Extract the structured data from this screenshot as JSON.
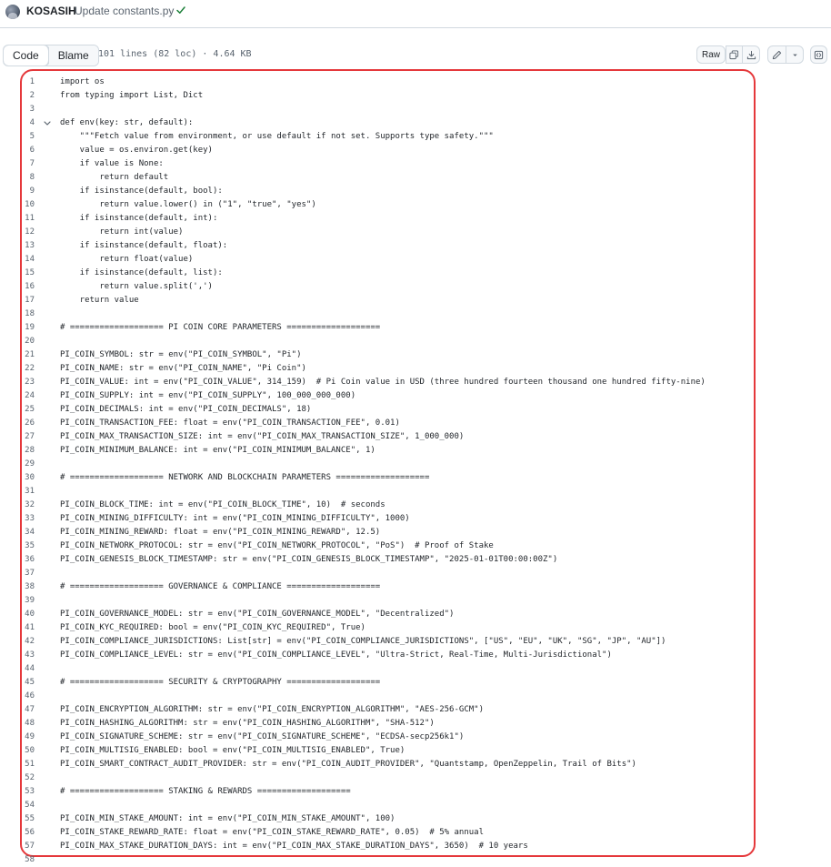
{
  "commit": {
    "author": "KOSASIH",
    "message": "Update constants.py",
    "status_icon": "check-icon",
    "status_color": "#1a7f37"
  },
  "file_header": {
    "tabs": [
      {
        "label": "Code",
        "active": true
      },
      {
        "label": "Blame",
        "active": false
      }
    ],
    "stats": "101 lines (82 loc) · 4.64 KB",
    "raw_label": "Raw",
    "icons": [
      "copy-icon",
      "download-icon",
      "pencil-icon",
      "chevron-down-icon",
      "symbols-panel-icon"
    ]
  },
  "highlight_border_color": "#e5383b",
  "code_lines": [
    "import os",
    "from typing import List, Dict",
    "",
    "def env(key: str, default):",
    "    \"\"\"Fetch value from environment, or use default if not set. Supports type safety.\"\"\"",
    "    value = os.environ.get(key)",
    "    if value is None:",
    "        return default",
    "    if isinstance(default, bool):",
    "        return value.lower() in (\"1\", \"true\", \"yes\")",
    "    if isinstance(default, int):",
    "        return int(value)",
    "    if isinstance(default, float):",
    "        return float(value)",
    "    if isinstance(default, list):",
    "        return value.split(',')",
    "    return value",
    "",
    "# =================== PI COIN CORE PARAMETERS ===================",
    "",
    "PI_COIN_SYMBOL: str = env(\"PI_COIN_SYMBOL\", \"Pi\")",
    "PI_COIN_NAME: str = env(\"PI_COIN_NAME\", \"Pi Coin\")",
    "PI_COIN_VALUE: int = env(\"PI_COIN_VALUE\", 314_159)  # Pi Coin value in USD (three hundred fourteen thousand one hundred fifty-nine)",
    "PI_COIN_SUPPLY: int = env(\"PI_COIN_SUPPLY\", 100_000_000_000)",
    "PI_COIN_DECIMALS: int = env(\"PI_COIN_DECIMALS\", 18)",
    "PI_COIN_TRANSACTION_FEE: float = env(\"PI_COIN_TRANSACTION_FEE\", 0.01)",
    "PI_COIN_MAX_TRANSACTION_SIZE: int = env(\"PI_COIN_MAX_TRANSACTION_SIZE\", 1_000_000)",
    "PI_COIN_MINIMUM_BALANCE: int = env(\"PI_COIN_MINIMUM_BALANCE\", 1)",
    "",
    "# =================== NETWORK AND BLOCKCHAIN PARAMETERS ===================",
    "",
    "PI_COIN_BLOCK_TIME: int = env(\"PI_COIN_BLOCK_TIME\", 10)  # seconds",
    "PI_COIN_MINING_DIFFICULTY: int = env(\"PI_COIN_MINING_DIFFICULTY\", 1000)",
    "PI_COIN_MINING_REWARD: float = env(\"PI_COIN_MINING_REWARD\", 12.5)",
    "PI_COIN_NETWORK_PROTOCOL: str = env(\"PI_COIN_NETWORK_PROTOCOL\", \"PoS\")  # Proof of Stake",
    "PI_COIN_GENESIS_BLOCK_TIMESTAMP: str = env(\"PI_COIN_GENESIS_BLOCK_TIMESTAMP\", \"2025-01-01T00:00:00Z\")",
    "",
    "# =================== GOVERNANCE & COMPLIANCE ===================",
    "",
    "PI_COIN_GOVERNANCE_MODEL: str = env(\"PI_COIN_GOVERNANCE_MODEL\", \"Decentralized\")",
    "PI_COIN_KYC_REQUIRED: bool = env(\"PI_COIN_KYC_REQUIRED\", True)",
    "PI_COIN_COMPLIANCE_JURISDICTIONS: List[str] = env(\"PI_COIN_COMPLIANCE_JURISDICTIONS\", [\"US\", \"EU\", \"UK\", \"SG\", \"JP\", \"AU\"])",
    "PI_COIN_COMPLIANCE_LEVEL: str = env(\"PI_COIN_COMPLIANCE_LEVEL\", \"Ultra-Strict, Real-Time, Multi-Jurisdictional\")",
    "",
    "# =================== SECURITY & CRYPTOGRAPHY ===================",
    "",
    "PI_COIN_ENCRYPTION_ALGORITHM: str = env(\"PI_COIN_ENCRYPTION_ALGORITHM\", \"AES-256-GCM\")",
    "PI_COIN_HASHING_ALGORITHM: str = env(\"PI_COIN_HASHING_ALGORITHM\", \"SHA-512\")",
    "PI_COIN_SIGNATURE_SCHEME: str = env(\"PI_COIN_SIGNATURE_SCHEME\", \"ECDSA-secp256k1\")",
    "PI_COIN_MULTISIG_ENABLED: bool = env(\"PI_COIN_MULTISIG_ENABLED\", True)",
    "PI_COIN_SMART_CONTRACT_AUDIT_PROVIDER: str = env(\"PI_COIN_AUDIT_PROVIDER\", \"Quantstamp, OpenZeppelin, Trail of Bits\")",
    "",
    "# =================== STAKING & REWARDS ===================",
    "",
    "PI_COIN_MIN_STAKE_AMOUNT: int = env(\"PI_COIN_MIN_STAKE_AMOUNT\", 100)",
    "PI_COIN_STAKE_REWARD_RATE: float = env(\"PI_COIN_STAKE_REWARD_RATE\", 0.05)  # 5% annual",
    "PI_COIN_MAX_STAKE_DURATION_DAYS: int = env(\"PI_COIN_MAX_STAKE_DURATION_DAYS\", 3650)  # 10 years",
    ""
  ],
  "fold_line": 4
}
